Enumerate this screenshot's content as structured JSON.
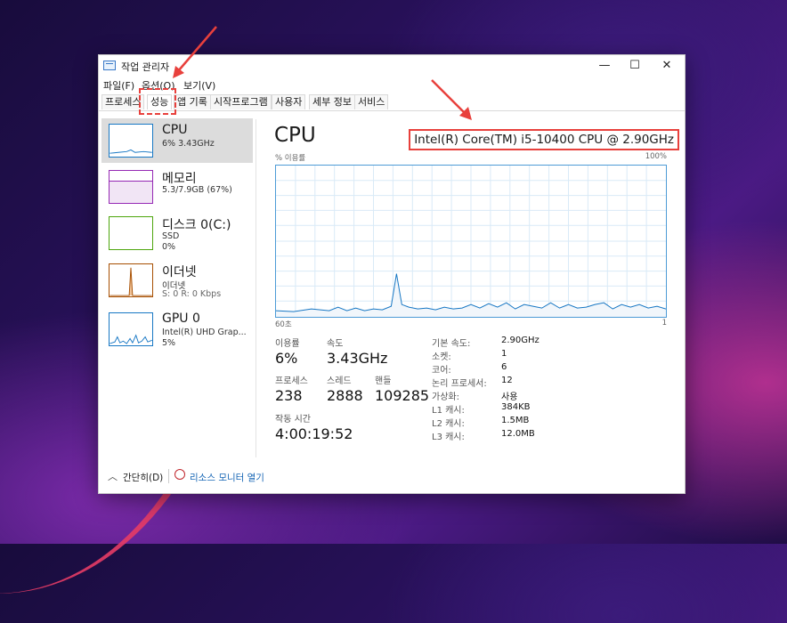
{
  "window": {
    "title": "작업 관리자",
    "minimize": "—",
    "maximize": "☐",
    "close": "✕"
  },
  "menu": [
    "파일(F)",
    "옵션(O)",
    "보기(V)"
  ],
  "tabs": [
    "프로세스",
    "성능",
    "앱 기록",
    "시작프로그램",
    "사용자",
    "세부 정보",
    "서비스"
  ],
  "active_tab": "성능",
  "sidebar": [
    {
      "name": "CPU",
      "sub1": "6% 3.43GHz",
      "color": "#1777c4"
    },
    {
      "name": "메모리",
      "sub1": "5.3/7.9GB (67%)",
      "color": "#9528b4"
    },
    {
      "name": "디스크 0(C:)",
      "sub1": "SSD",
      "sub2": "0%",
      "color": "#4da60c"
    },
    {
      "name": "이더넷",
      "sub1": "이더넷",
      "sub2": "S: 0 R: 0 Kbps",
      "color": "#a74f01"
    },
    {
      "name": "GPU 0",
      "sub1": "Intel(R) UHD Grap...",
      "sub2": "5%",
      "color": "#1777c4"
    }
  ],
  "main": {
    "title": "CPU",
    "model": "Intel(R) Core(TM) i5-10400 CPU @ 2.90GHz",
    "graph_ylabel": "% 이용률",
    "graph_ymax": "100%",
    "graph_xleft": "60초",
    "graph_xright": "1",
    "stats": {
      "util_label": "이용률",
      "util_value": "6%",
      "speed_label": "속도",
      "speed_value": "3.43GHz",
      "proc_label": "프로세스",
      "proc_value": "238",
      "thread_label": "스레드",
      "thread_value": "2888",
      "handle_label": "핸들",
      "handle_value": "109285",
      "uptime_label": "작동 시간",
      "uptime_value": "4:00:19:52"
    },
    "specs": [
      {
        "label": "기본 속도:",
        "value": "2.90GHz"
      },
      {
        "label": "소켓:",
        "value": "1"
      },
      {
        "label": "코어:",
        "value": "6"
      },
      {
        "label": "논리 프로세서:",
        "value": "12"
      },
      {
        "label": "가상화:",
        "value": "사용"
      },
      {
        "label": "L1 캐시:",
        "value": "384KB"
      },
      {
        "label": "L2 캐시:",
        "value": "1.5MB"
      },
      {
        "label": "L3 캐시:",
        "value": "12.0MB"
      }
    ]
  },
  "footer": {
    "collapse": "간단히(D)",
    "resmon": "리소스 모니터 열기"
  },
  "colors": {
    "accent": "#1777c4",
    "annotation": "#e8403c"
  }
}
